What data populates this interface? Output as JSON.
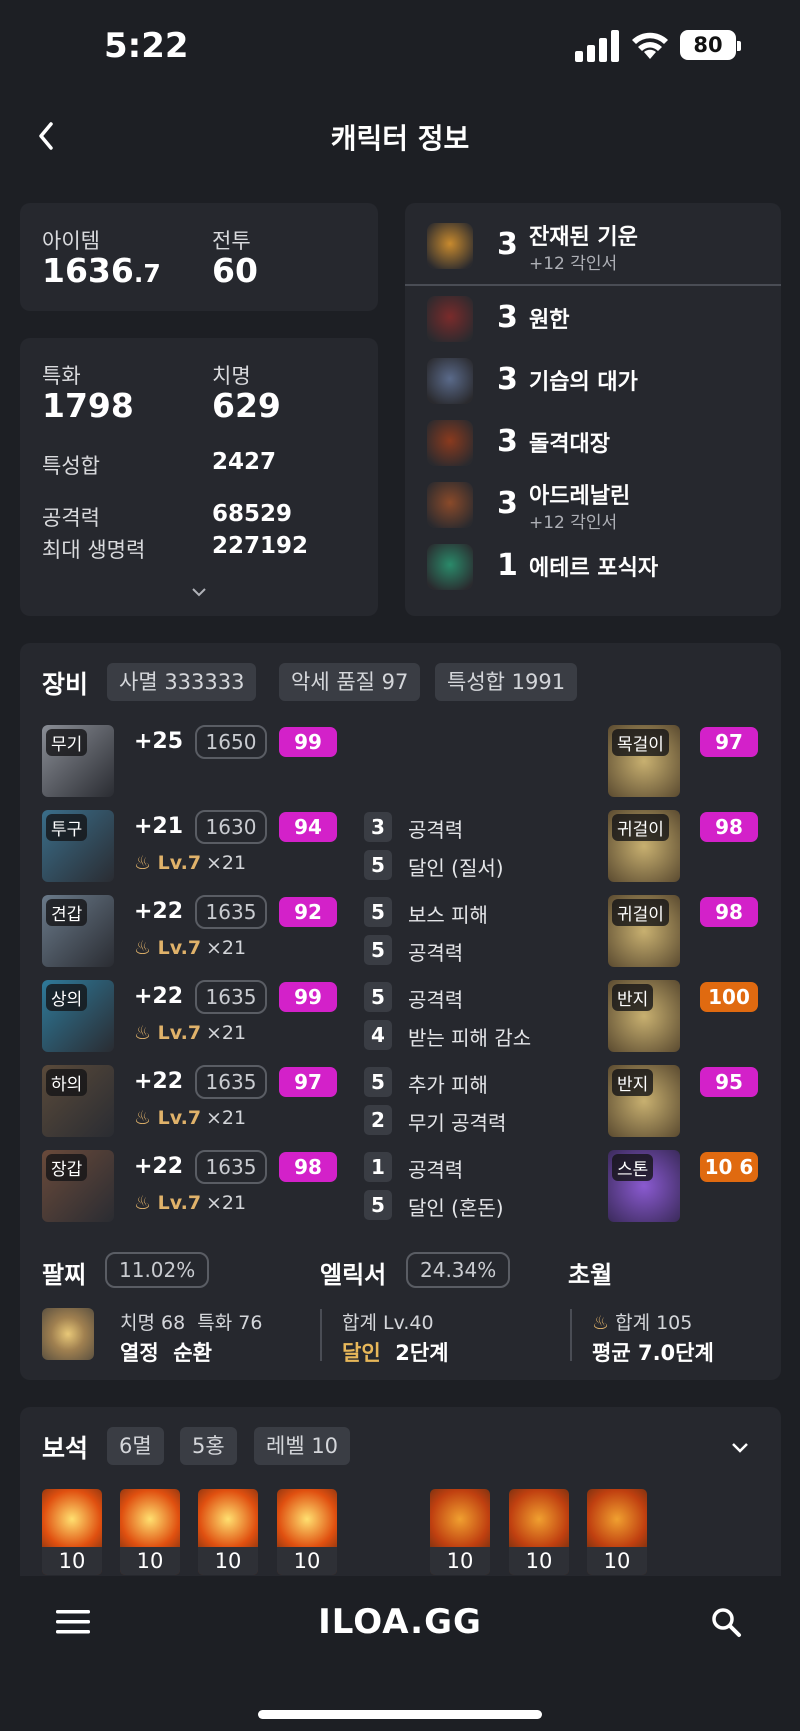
{
  "status": {
    "time": "5:22",
    "battery": "80"
  },
  "header": {
    "title": "캐릭터 정보"
  },
  "summary": {
    "item_label": "아이템",
    "item_value_main": "1636",
    "item_value_dec": ".7",
    "combat_label": "전투",
    "combat_value": "60"
  },
  "stats": {
    "spec_label": "특화",
    "spec_value": "1798",
    "crit_label": "치명",
    "crit_value": "629",
    "total_label": "특성합",
    "total_value": "2427",
    "atk_label": "공격력",
    "atk_value": "68529",
    "hp_label": "최대 생명력",
    "hp_value": "227192"
  },
  "engravings": [
    {
      "level": "3",
      "name": "잔재된 기운",
      "sub": "+12 각인서",
      "icon": "engraving-remnant-icon",
      "color": "#c88a2e"
    },
    {
      "level": "3",
      "name": "원한",
      "sub": "",
      "icon": "engraving-grudge-icon",
      "color": "#7a2b2b"
    },
    {
      "level": "3",
      "name": "기습의 대가",
      "sub": "",
      "icon": "engraving-ambush-icon",
      "color": "#5a6a8a"
    },
    {
      "level": "3",
      "name": "돌격대장",
      "sub": "",
      "icon": "engraving-raid-captain-icon",
      "color": "#8a3a1e"
    },
    {
      "level": "3",
      "name": "아드레날린",
      "sub": "+12 각인서",
      "icon": "engraving-adrenaline-icon",
      "color": "#8a4a2a"
    },
    {
      "level": "1",
      "name": "에테르 포식자",
      "sub": "",
      "icon": "engraving-ether-predator-icon",
      "color": "#2a8a6a"
    }
  ],
  "equipment": {
    "title": "장비",
    "chips": [
      "사멸 333333",
      "악세 품질 97",
      "특성합 1991"
    ],
    "armor": [
      {
        "slot": "무기",
        "plus": "+25",
        "ilvl": "1650",
        "quality": "99",
        "lv": "",
        "mult": ""
      },
      {
        "slot": "투구",
        "plus": "+21",
        "ilvl": "1630",
        "quality": "94",
        "lv": "Lv.7",
        "mult": "×21"
      },
      {
        "slot": "견갑",
        "plus": "+22",
        "ilvl": "1635",
        "quality": "92",
        "lv": "Lv.7",
        "mult": "×21"
      },
      {
        "slot": "상의",
        "plus": "+22",
        "ilvl": "1635",
        "quality": "99",
        "lv": "Lv.7",
        "mult": "×21"
      },
      {
        "slot": "하의",
        "plus": "+22",
        "ilvl": "1635",
        "quality": "97",
        "lv": "Lv.7",
        "mult": "×21"
      },
      {
        "slot": "장갑",
        "plus": "+22",
        "ilvl": "1635",
        "quality": "98",
        "lv": "Lv.7",
        "mult": "×21"
      }
    ],
    "effects": [
      [],
      [
        {
          "n": "3",
          "t": "공격력"
        },
        {
          "n": "5",
          "t": "달인 (질서)"
        }
      ],
      [
        {
          "n": "5",
          "t": "보스 피해"
        },
        {
          "n": "5",
          "t": "공격력"
        }
      ],
      [
        {
          "n": "5",
          "t": "공격력"
        },
        {
          "n": "4",
          "t": "받는 피해 감소"
        }
      ],
      [
        {
          "n": "5",
          "t": "추가 피해"
        },
        {
          "n": "2",
          "t": "무기 공격력"
        }
      ],
      [
        {
          "n": "1",
          "t": "공격력"
        },
        {
          "n": "5",
          "t": "달인 (혼돈)"
        }
      ]
    ],
    "accessories": [
      {
        "slot": "목걸이",
        "quality": "97",
        "color": "#d321c9"
      },
      {
        "slot": "귀걸이",
        "quality": "98",
        "color": "#d321c9"
      },
      {
        "slot": "귀걸이",
        "quality": "98",
        "color": "#d321c9"
      },
      {
        "slot": "반지",
        "quality": "100",
        "color": "#e06a10"
      },
      {
        "slot": "반지",
        "quality": "95",
        "color": "#d321c9"
      },
      {
        "slot": "스톤",
        "quality": "10 6",
        "color": "#e06a10"
      }
    ],
    "quality_color": "#d321c9"
  },
  "bracelet": {
    "label": "팔찌",
    "pct": "11.02%",
    "l1a": "치명 68",
    "l1b": "특화 76",
    "l2a": "열정",
    "l2b": "순환"
  },
  "elixir": {
    "label": "엘릭서",
    "pct": "24.34%",
    "line1": "합계 Lv.40",
    "hl": "달인",
    "line2": "2단계"
  },
  "transcend": {
    "label": "초월",
    "line1": "합계 105",
    "line2": "평균 7.0단계"
  },
  "gems": {
    "title": "보석",
    "chips": [
      "6멸",
      "5홍",
      "레벨 10"
    ],
    "items": [
      "10",
      "10",
      "10",
      "10",
      "10",
      "10",
      "10"
    ]
  },
  "bottom": {
    "logo": "ILOA.GG"
  }
}
